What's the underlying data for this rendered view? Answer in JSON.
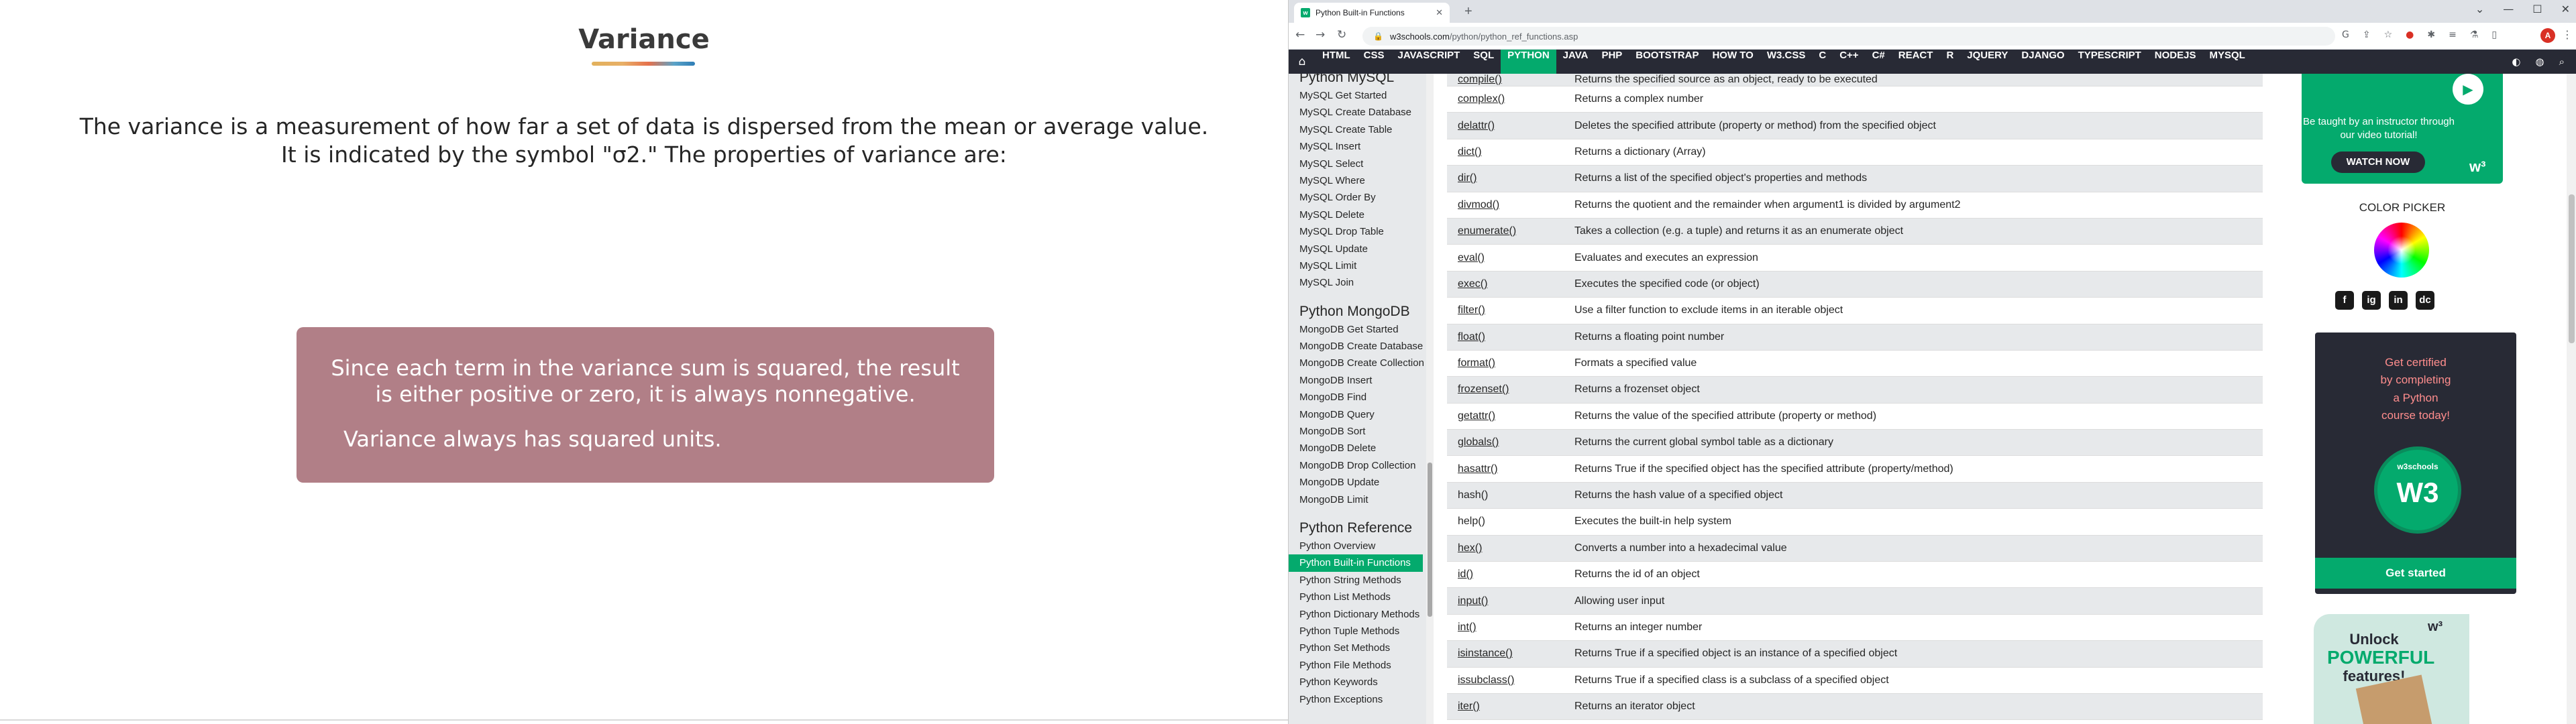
{
  "slide": {
    "title": "Variance",
    "intro_lines": [
      "The variance is a measurement of how far a set of data is dispersed from the mean or average value.",
      "It is indicated by the symbol \"σ2.\" The properties of variance are:"
    ],
    "box_lines": [
      "Since each term in the variance sum is squared, the result",
      "is either positive or zero, it is always nonnegative."
    ],
    "box_line_2": "Variance always has squared units."
  },
  "browser": {
    "tab_title": "Python Built-in Functions",
    "tab_favicon": "w",
    "url_domain": "w3schools.com",
    "url_path": "/python/python_ref_functions.asp",
    "profile_initial": "A",
    "topnav": [
      "HTML",
      "CSS",
      "JAVASCRIPT",
      "SQL",
      "PYTHON",
      "JAVA",
      "PHP",
      "BOOTSTRAP",
      "HOW TO",
      "W3.CSS",
      "C",
      "C++",
      "C#",
      "REACT",
      "R",
      "JQUERY",
      "DJANGO",
      "TYPESCRIPT",
      "NODEJS",
      "MYSQL"
    ],
    "topnav_active": "PYTHON",
    "accent_color": "#04aa6d",
    "nav_bg_color": "#282a35"
  },
  "sidebar": {
    "sections": [
      {
        "heading": "Python MySQL",
        "items": [
          "MySQL Get Started",
          "MySQL Create Database",
          "MySQL Create Table",
          "MySQL Insert",
          "MySQL Select",
          "MySQL Where",
          "MySQL Order By",
          "MySQL Delete",
          "MySQL Drop Table",
          "MySQL Update",
          "MySQL Limit",
          "MySQL Join"
        ]
      },
      {
        "heading": "Python MongoDB",
        "items": [
          "MongoDB Get Started",
          "MongoDB Create Database",
          "MongoDB Create Collection",
          "MongoDB Insert",
          "MongoDB Find",
          "MongoDB Query",
          "MongoDB Sort",
          "MongoDB Delete",
          "MongoDB Drop Collection",
          "MongoDB Update",
          "MongoDB Limit"
        ]
      },
      {
        "heading": "Python Reference",
        "items": [
          "Python Overview",
          "Python Built-in Functions",
          "Python String Methods",
          "Python List Methods",
          "Python Dictionary Methods",
          "Python Tuple Methods",
          "Python Set Methods",
          "Python File Methods",
          "Python Keywords",
          "Python Exceptions"
        ]
      }
    ],
    "active_item": "Python Built-in Functions"
  },
  "functions": [
    {
      "name": "compile()",
      "desc": "Returns the specified source as an object, ready to be executed"
    },
    {
      "name": "complex()",
      "desc": "Returns a complex number"
    },
    {
      "name": "delattr()",
      "desc": "Deletes the specified attribute (property or method) from the specified object"
    },
    {
      "name": "dict()",
      "desc": "Returns a dictionary (Array)"
    },
    {
      "name": "dir()",
      "desc": "Returns a list of the specified object's properties and methods"
    },
    {
      "name": "divmod()",
      "desc": "Returns the quotient and the remainder when argument1 is divided by argument2"
    },
    {
      "name": "enumerate()",
      "desc": "Takes a collection (e.g. a tuple) and returns it as an enumerate object"
    },
    {
      "name": "eval()",
      "desc": "Evaluates and executes an expression"
    },
    {
      "name": "exec()",
      "desc": "Executes the specified code (or object)"
    },
    {
      "name": "filter()",
      "desc": "Use a filter function to exclude items in an iterable object"
    },
    {
      "name": "float()",
      "desc": "Returns a floating point number"
    },
    {
      "name": "format()",
      "desc": "Formats a specified value"
    },
    {
      "name": "frozenset()",
      "desc": "Returns a frozenset object"
    },
    {
      "name": "getattr()",
      "desc": "Returns the value of the specified attribute (property or method)"
    },
    {
      "name": "globals()",
      "desc": "Returns the current global symbol table as a dictionary"
    },
    {
      "name": "hasattr()",
      "desc": "Returns True if the specified object has the specified attribute (property/method)"
    },
    {
      "name": "hash()",
      "desc": "Returns the hash value of a specified object",
      "plain": true
    },
    {
      "name": "help()",
      "desc": "Executes the built-in help system",
      "plain": true
    },
    {
      "name": "hex()",
      "desc": "Converts a number into a hexadecimal value"
    },
    {
      "name": "id()",
      "desc": "Returns the id of an object"
    },
    {
      "name": "input()",
      "desc": "Allowing user input"
    },
    {
      "name": "int()",
      "desc": "Returns an integer number"
    },
    {
      "name": "isinstance()",
      "desc": "Returns True if a specified object is an instance of a specified object"
    },
    {
      "name": "issubclass()",
      "desc": "Returns True if a specified class is a subclass of a specified object"
    },
    {
      "name": "iter()",
      "desc": "Returns an iterator object"
    }
  ],
  "ads": {
    "video_text": "Be taught by an instructor through our video tutorial!",
    "video_button": "WATCH NOW",
    "color_picker_label": "COLOR PICKER",
    "cert_text": [
      "Get certified",
      "by completing",
      "a Python",
      "course today!"
    ],
    "cert_badge_top": "w3schools",
    "cert_badge_mid": "W3",
    "cert_button": "Get started",
    "unlock_line1": "Unlock",
    "unlock_power": "POWERFUL",
    "unlock_line3": "features!",
    "social": [
      "f",
      "ig",
      "in",
      "dc"
    ]
  }
}
